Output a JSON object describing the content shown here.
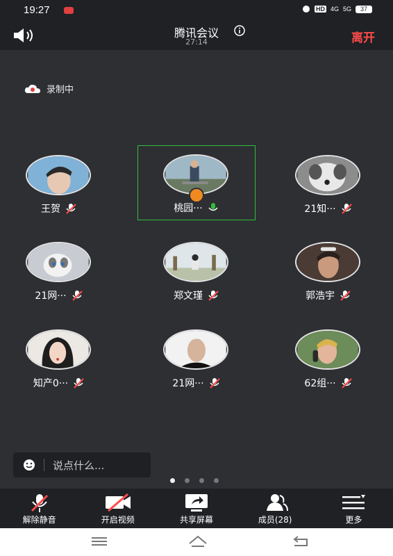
{
  "status": {
    "time": "19:27",
    "hd": "HD",
    "net1": "4G",
    "net2": "5G",
    "battery": "37"
  },
  "header": {
    "title": "腾讯会议",
    "timer": "27:14",
    "leave": "离开"
  },
  "recording": {
    "label": "录制中"
  },
  "participants": [
    {
      "name": "王贺",
      "mic": "muted"
    },
    {
      "name": "桃园···",
      "mic": "on"
    },
    {
      "name": "21知···",
      "mic": "muted"
    },
    {
      "name": "21网···",
      "mic": "muted"
    },
    {
      "name": "郑文瑾",
      "mic": "muted"
    },
    {
      "name": "郭浩宇",
      "mic": "muted"
    },
    {
      "name": "知产0···",
      "mic": "muted"
    },
    {
      "name": "21网···",
      "mic": "muted"
    },
    {
      "name": "62组···",
      "mic": "muted"
    }
  ],
  "chat": {
    "placeholder": "说点什么..."
  },
  "pager": {
    "total": 4,
    "current": 1
  },
  "toolbar": {
    "unmute": "解除静音",
    "video": "开启视频",
    "share": "共享屏幕",
    "members": "成员(28)",
    "more": "更多"
  },
  "colors": {
    "accent_green": "#2fbf3c",
    "leave_red": "#ff4b4b",
    "host_orange": "#f08a20"
  }
}
